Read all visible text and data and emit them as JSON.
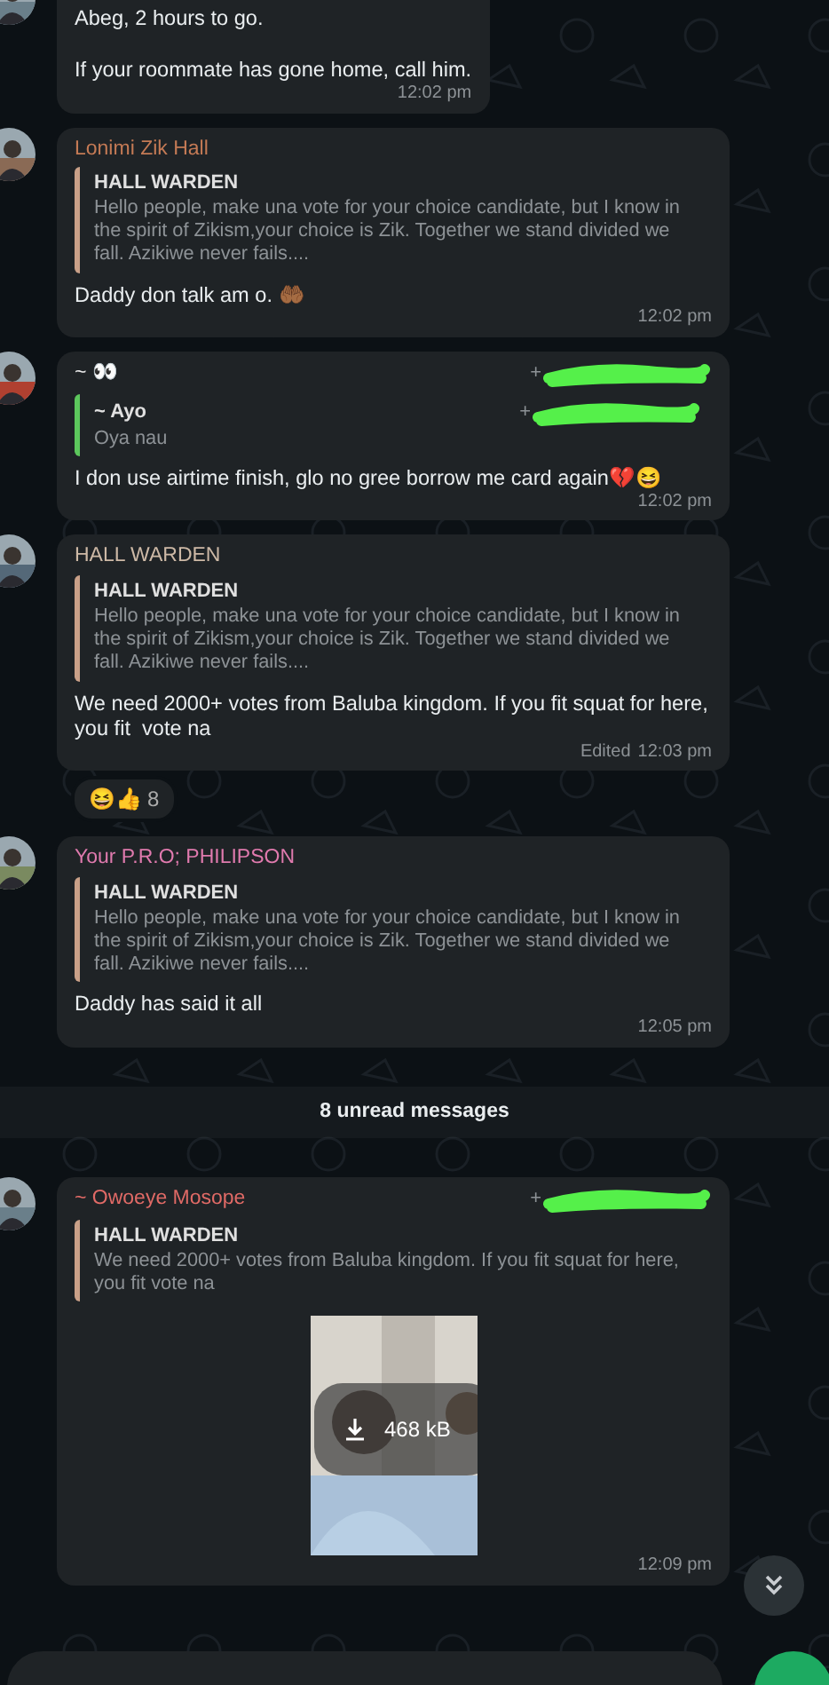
{
  "messages": [
    {
      "kind": "text",
      "top_cut": true,
      "body": "Abeg, 2 hours to go.\n\nIf your roommate has gone home, call him.",
      "time": "12:02 pm"
    },
    {
      "kind": "text",
      "sender": "Lonimi Zik Hall",
      "color": "#c47a55",
      "quote": {
        "author": "HALL WARDEN",
        "text": "Hello people, make una vote for your choice candidate, but I know in the spirit of Zikism,your choice is Zik. Together we stand divided we fall. Azikiwe never fails....",
        "color": "#c9a088"
      },
      "body": "Daddy don talk am o. 🤲🏾",
      "time": "12:02 pm"
    },
    {
      "kind": "text",
      "sender": "~ 👀",
      "color": "#e8e8e8",
      "phone": {
        "prefix": "+",
        "redacted": true
      },
      "quote": {
        "author": "~ Ayo",
        "text": "Oya nau",
        "color": "#5cc75c",
        "phone": {
          "prefix": "+",
          "redacted": true
        }
      },
      "body": "I don use airtime finish, glo no gree borrow me card again💔😆",
      "time": "12:02 pm"
    },
    {
      "kind": "text",
      "sender": "HALL WARDEN",
      "color": "#cdb9a6",
      "quote": {
        "author": "HALL WARDEN",
        "text": "Hello people, make una vote for your choice candidate, but I know in the spirit of Zikism,your choice is Zik. Together we stand divided we fall. Azikiwe never fails....",
        "color": "#c9a088"
      },
      "body": "We need 2000+ votes from Baluba kingdom. If you fit squat for here, you fit  vote na",
      "edited_label": "Edited",
      "time": "12:03 pm",
      "reactions": {
        "emojis": "😆👍",
        "count": "8"
      }
    },
    {
      "kind": "text",
      "sender": "Your P.R.O; PHILIPSON",
      "color": "#e07aae",
      "quote": {
        "author": "HALL WARDEN",
        "text": "Hello people, make una vote for your choice candidate, but I know in the spirit of Zikism,your choice is Zik. Together we stand divided we fall. Azikiwe never fails....",
        "color": "#c9a088"
      },
      "body": "Daddy has said it all",
      "time": "12:05 pm"
    },
    {
      "kind": "divider",
      "text": "8 unread messages"
    },
    {
      "kind": "media",
      "sender": "~ Owoeye Mosope",
      "color": "#e06a66",
      "phone": {
        "prefix": "+",
        "redacted": true
      },
      "quote": {
        "author": "HALL WARDEN",
        "text": "We need 2000+ votes from Baluba kingdom. If you fit squat for here, you fit  vote na",
        "color": "#c9a088"
      },
      "media": {
        "kind": "picture",
        "size": "468 kB"
      },
      "time": "12:09 pm"
    }
  ]
}
